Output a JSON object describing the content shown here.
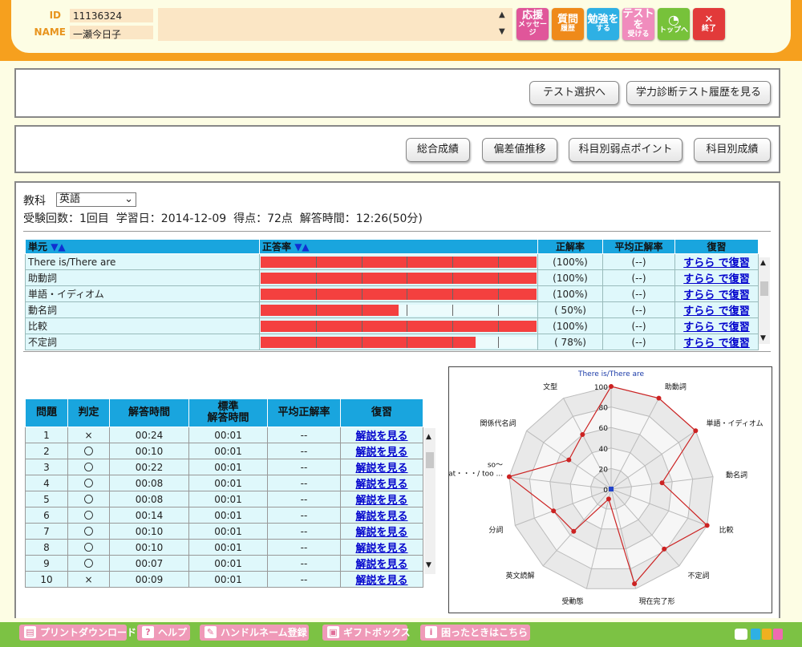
{
  "header": {
    "id_label": "ID",
    "id_value": "11136324",
    "name_label": "NAME",
    "name_value": "一瀬今日子"
  },
  "top_buttons": [
    {
      "l1": "応援",
      "l2": "メッセージ",
      "color": "#e0569a"
    },
    {
      "l1": "質問",
      "l2": "履歴",
      "color": "#ef8a1a"
    },
    {
      "l1": "勉強を",
      "l2": "する",
      "color": "#2eb0e4"
    },
    {
      "l1": "テストを",
      "l2": "受ける",
      "color": "#f08cbd"
    },
    {
      "l1": "",
      "l2": "トップへ",
      "color": "#77c23a"
    },
    {
      "l1": "✕",
      "l2": "終了",
      "color": "#e23a3a"
    }
  ],
  "nav1": {
    "test_select": "テスト選択へ",
    "history": "学力診断テスト履歴を見る"
  },
  "nav2": {
    "overall": "総合成績",
    "deviation": "偏差値推移",
    "weak_points": "科目別弱点ポイント",
    "by_subject": "科目別成績"
  },
  "subject": {
    "label": "教科",
    "selected": "英語"
  },
  "summary": "受験回数：1回目  学習日：2014-12-09  得点：72点  解答時間：12:26(50分)",
  "unit_table": {
    "headers": [
      "単元",
      "正答率",
      "正解率",
      "平均正解率",
      "復習"
    ],
    "sort_arrows": "▼▲",
    "rows": [
      {
        "name": "There is/There are",
        "rate": "(100%)",
        "avg": "(--)",
        "review": "すらら で復習",
        "pct": 100
      },
      {
        "name": "助動詞",
        "rate": "(100%)",
        "avg": "(--)",
        "review": "すらら で復習",
        "pct": 100
      },
      {
        "name": "単語・イディオム",
        "rate": "(100%)",
        "avg": "(--)",
        "review": "すらら で復習",
        "pct": 100
      },
      {
        "name": "動名詞",
        "rate": "( 50%)",
        "avg": "(--)",
        "review": "すらら で復習",
        "pct": 50
      },
      {
        "name": "比較",
        "rate": "(100%)",
        "avg": "(--)",
        "review": "すらら で復習",
        "pct": 100
      },
      {
        "name": "不定詞",
        "rate": "( 78%)",
        "avg": "(--)",
        "review": "すらら で復習",
        "pct": 78
      }
    ]
  },
  "question_table": {
    "headers": [
      "問題",
      "判定",
      "解答時間",
      "標準\n解答時間",
      "平均正解率",
      "復習"
    ],
    "rows": [
      {
        "no": "1",
        "judge": "×",
        "time": "00:24",
        "std": "00:01",
        "avg": "--",
        "review": "解説を見る"
      },
      {
        "no": "2",
        "judge": "〇",
        "time": "00:10",
        "std": "00:01",
        "avg": "--",
        "review": "解説を見る"
      },
      {
        "no": "3",
        "judge": "〇",
        "time": "00:22",
        "std": "00:01",
        "avg": "--",
        "review": "解説を見る"
      },
      {
        "no": "4",
        "judge": "〇",
        "time": "00:08",
        "std": "00:01",
        "avg": "--",
        "review": "解説を見る"
      },
      {
        "no": "5",
        "judge": "〇",
        "time": "00:08",
        "std": "00:01",
        "avg": "--",
        "review": "解説を見る"
      },
      {
        "no": "6",
        "judge": "〇",
        "time": "00:14",
        "std": "00:01",
        "avg": "--",
        "review": "解説を見る"
      },
      {
        "no": "7",
        "judge": "〇",
        "time": "00:10",
        "std": "00:01",
        "avg": "--",
        "review": "解説を見る"
      },
      {
        "no": "8",
        "judge": "〇",
        "time": "00:10",
        "std": "00:01",
        "avg": "--",
        "review": "解説を見る"
      },
      {
        "no": "9",
        "judge": "〇",
        "time": "00:07",
        "std": "00:01",
        "avg": "--",
        "review": "解説を見る"
      },
      {
        "no": "10",
        "judge": "×",
        "time": "00:09",
        "std": "00:01",
        "avg": "--",
        "review": "解説を見る"
      }
    ]
  },
  "chart_data": {
    "type": "radar",
    "categories": [
      "There is/There are",
      "助動詞",
      "単語・イディオム",
      "動名詞",
      "比較",
      "不定詞",
      "現在完了形",
      "受動態",
      "英文読解",
      "分詞",
      "so～ that・・・/ too ...",
      "関係代名詞",
      "文型"
    ],
    "values": [
      100,
      100,
      100,
      50,
      100,
      78,
      95,
      10,
      55,
      60,
      100,
      50,
      60
    ],
    "rlim": [
      0,
      100
    ],
    "ticks": [
      0,
      20,
      40,
      60,
      80,
      100
    ],
    "line_color": "#cc2222"
  },
  "bottom_buttons": [
    "プリントダウンロード",
    "ヘルプ",
    "ハンドルネーム登録",
    "ギフトボックス",
    "困ったときはこちら"
  ],
  "bottom_icons": [
    "?",
    "i"
  ]
}
